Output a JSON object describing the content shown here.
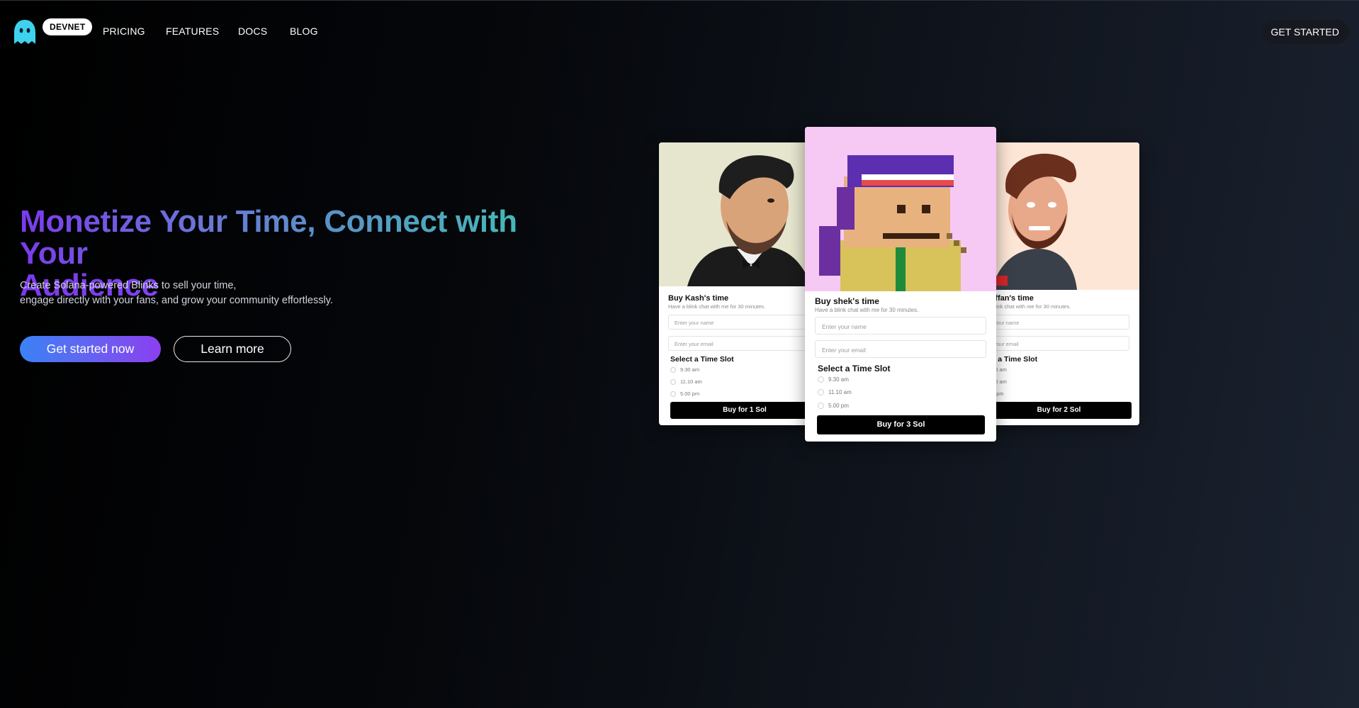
{
  "nav": {
    "network_badge": "DEVNET",
    "links": [
      "PRICING",
      "FEATURES",
      "DOCS",
      "BLOG"
    ],
    "cta": "GET STARTED"
  },
  "hero": {
    "title_line1": "Monetize Your Time, Connect with Your",
    "title_line2": "Audience",
    "subtitle_line1": "Create Solana-powered Blinks to sell your time,",
    "subtitle_line2": "engage directly with your fans, and grow your community effortlessly.",
    "primary_button": "Get started now",
    "secondary_button": "Learn more"
  },
  "cards": [
    {
      "title": "Buy Kash's time",
      "description": "Have a blink chat with me for 30 minutes.",
      "name_placeholder": "Enter your name",
      "email_placeholder": "Enter your email",
      "slot_heading": "Select a Time Slot",
      "slots": [
        "9.30 am",
        "11.10 am",
        "5.00 pm"
      ],
      "buy_label": "Buy for 1 Sol",
      "image_bg": "#e6e6cf"
    },
    {
      "title": "Buy shek's time",
      "description": "Have a blink chat with me for 30 minutes.",
      "name_placeholder": "Enter your name",
      "email_placeholder": "Enter your email",
      "slot_heading": "Select a Time Slot",
      "slots": [
        "9.30 am",
        "11.10 am",
        "5.00 pm"
      ],
      "buy_label": "Buy for 3 Sol",
      "image_bg": "#f6c8f4"
    },
    {
      "title": "rffan's time",
      "description": "blink chat with me for 30 minutes.",
      "name_placeholder": "your name",
      "email_placeholder": "your email",
      "slot_heading": "ct a Time Slot",
      "slots": [
        "30 am",
        "10 am",
        "0 pm"
      ],
      "buy_label": "Buy for 2 Sol",
      "image_bg": "#fde6d6"
    }
  ],
  "colors": {
    "accent_purple": "#7c3aed",
    "accent_teal": "#3ec6ae",
    "button_blue": "#3b82f6"
  }
}
